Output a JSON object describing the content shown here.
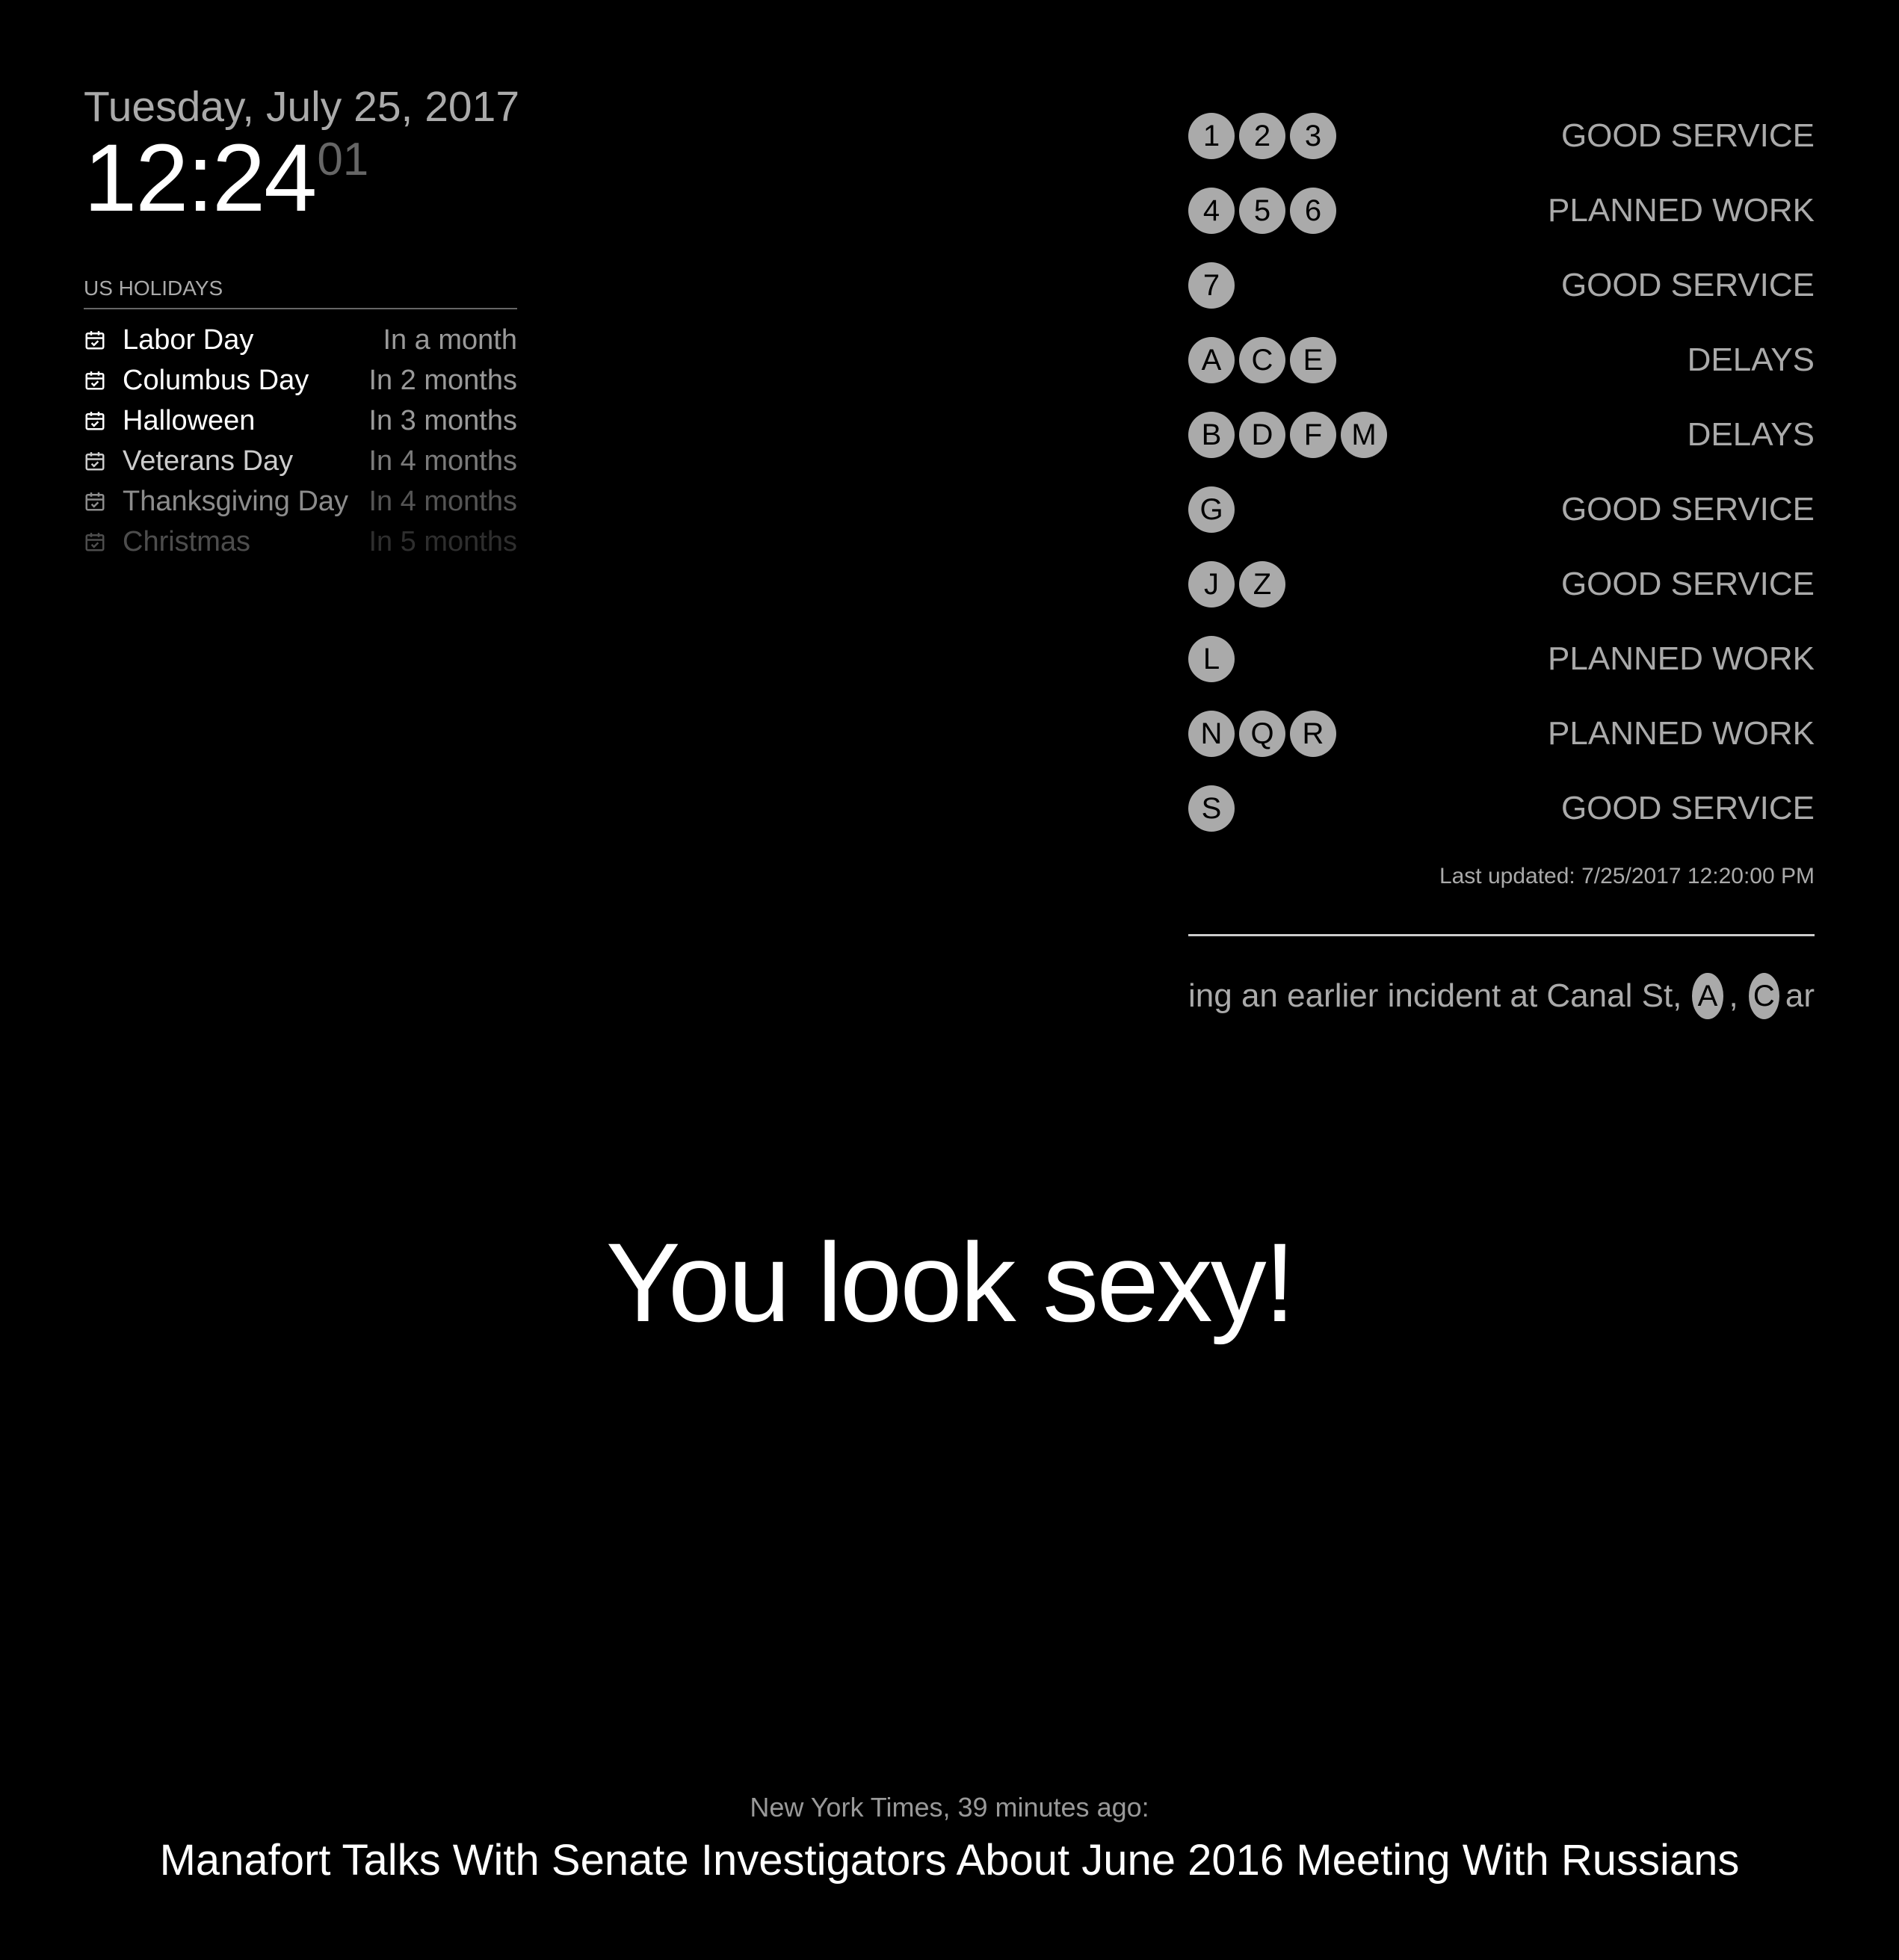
{
  "clock": {
    "date": "Tuesday, July 25, 2017",
    "time_hm": "12:24",
    "time_seconds": "01"
  },
  "calendar": {
    "header": "US HOLIDAYS",
    "icon": "calendar-check-icon",
    "events": [
      {
        "title": "Labor Day",
        "when": "In a month",
        "opacity": 1.0
      },
      {
        "title": "Columbus Day",
        "when": "In 2 months",
        "opacity": 1.0
      },
      {
        "title": "Halloween",
        "when": "In 3 months",
        "opacity": 1.0
      },
      {
        "title": "Veterans Day",
        "when": "In 4 months",
        "opacity": 0.8
      },
      {
        "title": "Thanksgiving Day",
        "when": "In 4 months",
        "opacity": 0.55
      },
      {
        "title": "Christmas",
        "when": "In 5 months",
        "opacity": 0.3
      }
    ]
  },
  "mta": {
    "lines": [
      {
        "routes": [
          "1",
          "2",
          "3"
        ],
        "status": "GOOD SERVICE"
      },
      {
        "routes": [
          "4",
          "5",
          "6"
        ],
        "status": "PLANNED WORK"
      },
      {
        "routes": [
          "7"
        ],
        "status": "GOOD SERVICE"
      },
      {
        "routes": [
          "A",
          "C",
          "E"
        ],
        "status": "DELAYS"
      },
      {
        "routes": [
          "B",
          "D",
          "F",
          "M"
        ],
        "status": "DELAYS"
      },
      {
        "routes": [
          "G"
        ],
        "status": "GOOD SERVICE"
      },
      {
        "routes": [
          "J",
          "Z"
        ],
        "status": "GOOD SERVICE"
      },
      {
        "routes": [
          "L"
        ],
        "status": "PLANNED WORK"
      },
      {
        "routes": [
          "N",
          "Q",
          "R"
        ],
        "status": "PLANNED WORK"
      },
      {
        "routes": [
          "S"
        ],
        "status": "GOOD SERVICE"
      }
    ],
    "last_updated": "Last updated: 7/25/2017 12:20:00 PM",
    "ticker": {
      "text": "ing an earlier incident at Canal St,",
      "bullet_1": "A",
      "separator": ",",
      "bullet_2": "C",
      "tail": "ar"
    }
  },
  "compliment": {
    "text": "You look sexy!"
  },
  "news": {
    "source": "New York Times, 39 minutes ago:",
    "headline": "Manafort Talks With Senate Investigators About June 2016 Meeting With Russians"
  },
  "colors": {
    "background": "#000000",
    "primary_text": "#ffffff",
    "dimmed_text": "#aaaaaa",
    "route_bullet": "#aaaaaa"
  }
}
